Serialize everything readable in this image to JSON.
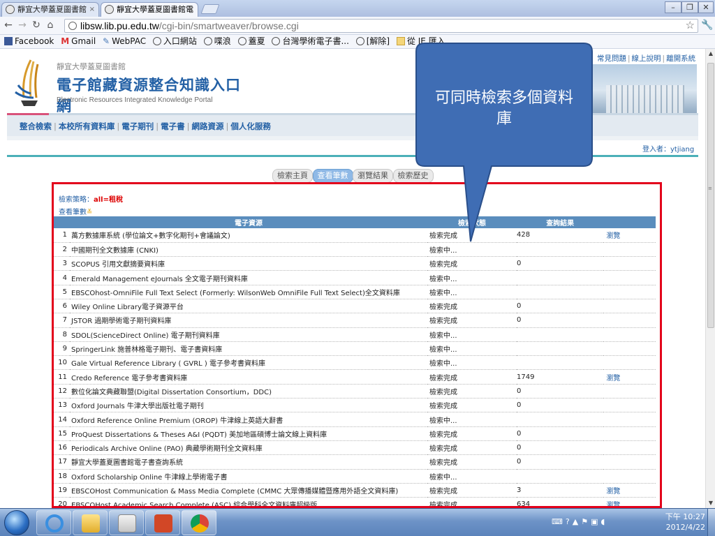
{
  "browser": {
    "tabs": [
      {
        "label": "靜宜大學蓋夏圖書館",
        "active": false
      },
      {
        "label": "靜宜大學蓋夏圖書館電",
        "active": true
      }
    ],
    "url_host": "libsw.lib.pu.edu.tw",
    "url_path": "/cgi-bin/smartweaver/browse.cgi",
    "bookmarks": [
      "Facebook",
      "Gmail",
      "WebPAC",
      "入口網站",
      "喋浪",
      "蓋夏",
      "台灣學術電子書...",
      "[解除]",
      "從 IE 匯入"
    ]
  },
  "header": {
    "library_name": "靜宜大學蓋夏圖書館",
    "portal_title": "電子館藏資源整合知識入口網",
    "portal_title_en": "Electronic Resources Integrated Knowledge Portal",
    "top_links": [
      "常見問題",
      "線上說明",
      "離開系統"
    ],
    "menu": [
      "整合檢索",
      "本校所有資料庫",
      "電子期刊",
      "電子書",
      "網路資源",
      "個人化服務"
    ],
    "login": "登入者：ytjiang"
  },
  "subtabs": [
    {
      "label": "檢索主頁",
      "active": false
    },
    {
      "label": "查看筆數",
      "active": true
    },
    {
      "label": "瀏覽結果",
      "active": false
    },
    {
      "label": "檢索歷史",
      "active": false
    }
  ],
  "strategy_label": "檢索策略：",
  "strategy_value": "all=租稅",
  "query_count_label": "查看筆數",
  "table": {
    "headers": [
      "電子資源",
      "檢索狀態",
      "查詢結果"
    ],
    "rows": [
      {
        "idx": "1",
        "name": "萬方數據庫系統 (學位論文+數字化期刊+會議論文)",
        "status": "檢索完成",
        "count": "428",
        "view": "瀏覽"
      },
      {
        "idx": "2",
        "name": "中國期刊全文數據庫 (CNKI)",
        "status": "檢索中...",
        "count": "",
        "view": ""
      },
      {
        "idx": "3",
        "name": "SCOPUS 引用文獻摘要資料庫",
        "status": "檢索完成",
        "count": "0",
        "view": ""
      },
      {
        "idx": "4",
        "name": "Emerald Management eJournals 全文電子期刊資料庫",
        "status": "檢索中...",
        "count": "",
        "view": ""
      },
      {
        "idx": "5",
        "name": "EBSCOhost-OmniFile Full Text Select (Formerly: WilsonWeb OmniFile Full Text Select)全文資料庫",
        "status": "檢索中...",
        "count": "",
        "view": ""
      },
      {
        "idx": "6",
        "name": "Wiley Online Library電子資源平台",
        "status": "檢索完成",
        "count": "0",
        "view": ""
      },
      {
        "idx": "7",
        "name": "JSTOR 過期學術電子期刊資料庫",
        "status": "檢索完成",
        "count": "0",
        "view": ""
      },
      {
        "idx": "8",
        "name": "SDOL(ScienceDirect Online) 電子期刊資料庫",
        "status": "檢索中...",
        "count": "",
        "view": ""
      },
      {
        "idx": "9",
        "name": "SpringerLink 施普林格電子期刊、電子書資料庫",
        "status": "檢索中...",
        "count": "",
        "view": ""
      },
      {
        "idx": "10",
        "name": "Gale Virtual Reference Library ( GVRL ) 電子參考書資料庫",
        "status": "檢索中...",
        "count": "",
        "view": ""
      },
      {
        "idx": "11",
        "name": "Credo Reference 電子參考書資料庫",
        "status": "檢索完成",
        "count": "1749",
        "view": "瀏覽"
      },
      {
        "idx": "12",
        "name": "數位化論文典藏聯盟(Digital Dissertation Consortium，DDC)",
        "status": "檢索完成",
        "count": "0",
        "view": ""
      },
      {
        "idx": "13",
        "name": "Oxford Journals 牛津大學出版社電子期刊",
        "status": "檢索完成",
        "count": "0",
        "view": ""
      },
      {
        "idx": "14",
        "name": "Oxford Reference Online Premium (OROP) 牛津線上英語大辭書",
        "status": "檢索中...",
        "count": "",
        "view": ""
      },
      {
        "idx": "15",
        "name": "ProQuest Dissertations & Theses A&I (PQDT) 美加地區碩博士論文線上資料庫",
        "status": "檢索完成",
        "count": "0",
        "view": ""
      },
      {
        "idx": "16",
        "name": "Periodicals Archive Online (PAO) 典藏學術期刊全文資料庫",
        "status": "檢索完成",
        "count": "0",
        "view": ""
      },
      {
        "idx": "17",
        "name": "靜宜大學蓋夏圖書館電子書查詢系統",
        "status": "檢索完成",
        "count": "0",
        "view": ""
      },
      {
        "idx": "18",
        "name": "Oxford Scholarship Online 牛津線上學術電子書",
        "status": "檢索中...",
        "count": "",
        "view": ""
      },
      {
        "idx": "19",
        "name": "EBSCOHost Communication & Mass Media Complete (CMMC 大眾傳播媒體暨應用外語全文資料庫)",
        "status": "檢索完成",
        "count": "3",
        "view": "瀏覽"
      },
      {
        "idx": "20",
        "name": "EBSCOHost Academic Search Complete (ASC) 綜合學科全文資料庫超級版",
        "status": "檢索完成",
        "count": "634",
        "view": "瀏覽"
      }
    ]
  },
  "callout_text": "可同時檢索多個資料庫",
  "taskbar": {
    "clock_time": "下午 10:27",
    "clock_date": "2012/4/22"
  },
  "colors": {
    "callout_fill": "#3f6db4",
    "highlight_box": "#e3001b",
    "table_header": "#5a8dbd",
    "link_blue": "#2360a5"
  }
}
